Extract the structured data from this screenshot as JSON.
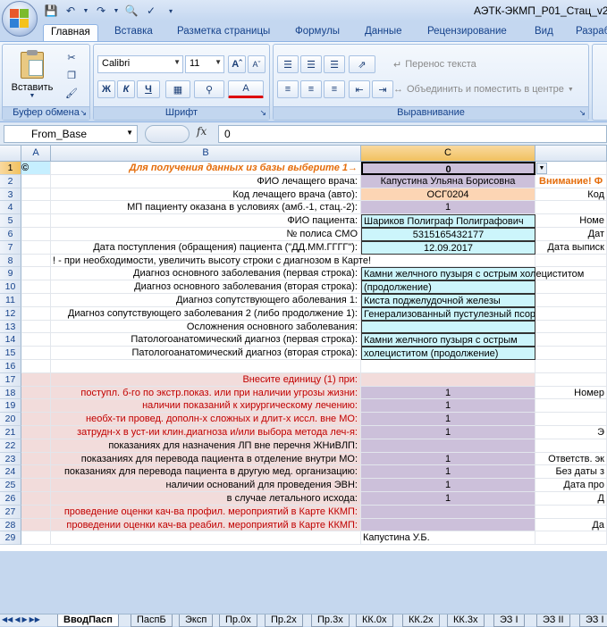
{
  "window": {
    "title": "АЭТК-ЭКМП_Р01_Стац_v201"
  },
  "ribbon_tabs": [
    "Главная",
    "Вставка",
    "Разметка страницы",
    "Формулы",
    "Данные",
    "Рецензирование",
    "Вид",
    "Разраб"
  ],
  "clipboard": {
    "paste_label": "Вставить",
    "group_label": "Буфер обмена"
  },
  "font": {
    "name": "Calibri",
    "size": "11",
    "group_label": "Шрифт",
    "bold": "Ж",
    "italic": "К",
    "underline": "Ч"
  },
  "alignment": {
    "wrap_text": "Перенос текста",
    "merge_center": "Объединить и поместить в центре",
    "group_label": "Выравнивание"
  },
  "formula_bar": {
    "name_box": "From_Base",
    "fx": "fx",
    "content": "0"
  },
  "columns": [
    "A",
    "B",
    "C"
  ],
  "rows": [
    {
      "n": "1",
      "a": "©",
      "b": "Для получения данных  из базы выберите 1→",
      "c": "0",
      "d": "Внимание! Ф"
    },
    {
      "n": "2",
      "b": "ФИО лечащего врача:",
      "c": "Капустина Ульяна Борисовна",
      "d": "Внимание! Ф"
    },
    {
      "n": "3",
      "b": "Код лечащего врача (авто):",
      "c": "ОСГ0204",
      "d": "Код"
    },
    {
      "n": "4",
      "b": "МП пациенту оказана в условиях (амб.-1, стац.-2):",
      "c": "1",
      "d": ""
    },
    {
      "n": "5",
      "b": "ФИО пациента:",
      "c": "Шариков Полиграф Полиграфович",
      "d": "Номе"
    },
    {
      "n": "6",
      "b": "№ полиса СМО",
      "c": "5315165432177",
      "d": "Дат"
    },
    {
      "n": "7",
      "b": "Дата поступления (обращения) пациента (\"ДД.ММ.ГГГГ\"):",
      "c": "12.09.2017",
      "d": "Дата выписк"
    },
    {
      "n": "8",
      "b": "! - при необходимости, увеличить высоту строки с диагнозом в Карте!",
      "c": "",
      "d": ""
    },
    {
      "n": "9",
      "b": "Диагноз основного заболевания (первая строка):",
      "c": "Камни желчного пузыря с острым холециститом",
      "d": ""
    },
    {
      "n": "10",
      "b": "Диагноз основного заболевания (вторая строка):",
      "c": "(продолжение)",
      "d": ""
    },
    {
      "n": "11",
      "b": "Диагноз сопутствующего аболевания 1:",
      "c": "Киста поджелудочной железы",
      "d": ""
    },
    {
      "n": "12",
      "b": "Диагноз сопутствующего заболевания 2 (либо продолжение 1):",
      "c": "Генерализованный пустулезный псориаз",
      "d": ""
    },
    {
      "n": "13",
      "b": "Осложнения основного заболевания:",
      "c": "",
      "d": ""
    },
    {
      "n": "14",
      "b": "Патологоанатомический диагноз (первая строка):",
      "c": "Камни желчного пузыря с острым",
      "d": ""
    },
    {
      "n": "15",
      "b": "Патологоанатомический диагноз (вторая строка):",
      "c": "холециститом (продолжение)",
      "d": ""
    },
    {
      "n": "16",
      "b": "",
      "c": "",
      "d": ""
    },
    {
      "n": "17",
      "b": "Внесите единицу (1) при:",
      "c": "",
      "d": ""
    },
    {
      "n": "18",
      "b": "поступл. б-го по экстр.показ. или при наличии угрозы жизни:",
      "c": "1",
      "d": "Номер"
    },
    {
      "n": "19",
      "b": "наличии показаний к хирургическому лечению:",
      "c": "1",
      "d": ""
    },
    {
      "n": "20",
      "b": "необх-ти провед. дополн-х сложных и длит-х иссл. вне МО:",
      "c": "1",
      "d": ""
    },
    {
      "n": "21",
      "b": "затрудн-х в уст-ии клин.диагноза и/или выбора метода леч-я:",
      "c": "1",
      "d": "Э"
    },
    {
      "n": "22",
      "b": "показаниях для назначения ЛП вне перечня ЖНиВЛП:",
      "c": "",
      "d": ""
    },
    {
      "n": "23",
      "b": "показаниях для перевода пациента в отделение внутри МО:",
      "c": "1",
      "d": "Ответств. эк"
    },
    {
      "n": "24",
      "b": "показаниях для перевода пациента в другую мед. организацию:",
      "c": "1",
      "d": "Без даты з"
    },
    {
      "n": "25",
      "b": "наличии оснований для проведения ЭВН:",
      "c": "1",
      "d": "Дата про"
    },
    {
      "n": "26",
      "b": "в случае летального исхода:",
      "c": "1",
      "d": "Д"
    },
    {
      "n": "27",
      "b": "проведение оценки кач-ва профил. мероприятий в Карте ККМП:",
      "c": "",
      "d": ""
    },
    {
      "n": "28",
      "b": "проведении оценки кач-ва реабил. мероприятий в  Карте ККМП:",
      "c": "",
      "d": "Да"
    },
    {
      "n": "29",
      "b": "",
      "c": "Капустина У.Б.",
      "d": ""
    }
  ],
  "sheet_tabs": [
    "ВводПасп",
    "ПаспБ",
    "Эксп",
    "Пр.0х",
    "Пр.2х",
    "Пр.3х",
    "КК.0х",
    "КК.2х",
    "КК.3х",
    "ЭЗ I",
    "ЭЗ II",
    "ЭЗ I"
  ],
  "colors": {
    "lavender": "#ccc0da",
    "peach": "#fcd5b4",
    "cyan": "#ccf5fb",
    "pink": "#f2dcdb",
    "red_text": "#c00000",
    "orange_text": "#e46c0a"
  }
}
